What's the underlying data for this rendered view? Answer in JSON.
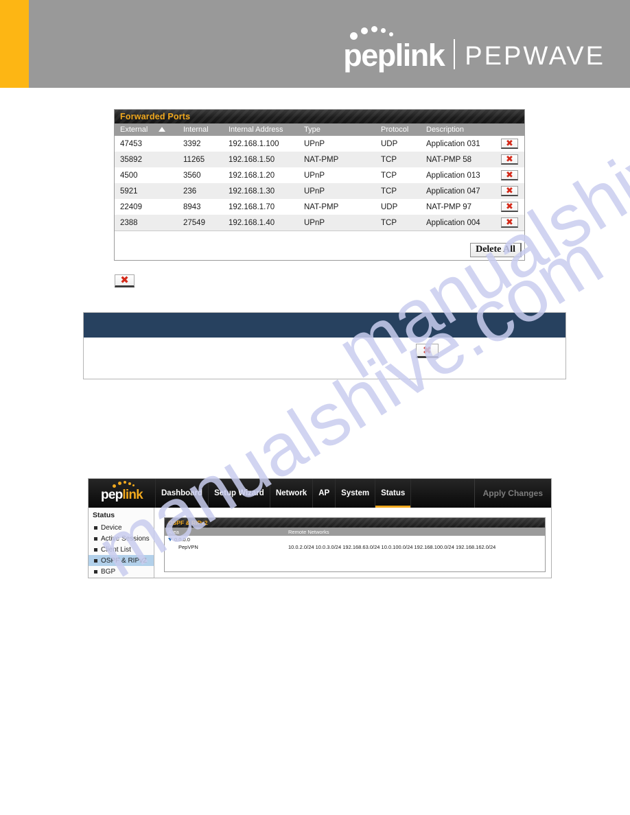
{
  "document_header": {
    "brand_primary": "peplink",
    "brand_secondary": "PEPWAVE",
    "accent_orange": "#fdb614",
    "band_gray": "#999999"
  },
  "watermark": {
    "text": "manualshive.com"
  },
  "forwarded_ports": {
    "title": "Forwarded Ports",
    "title_color": "#f0a81e",
    "columns": [
      "External",
      "Internal",
      "Internal Address",
      "Type",
      "Protocol",
      "Description"
    ],
    "sort_column": "External",
    "sort_direction": "ascending",
    "sort_icon": "sort-ascending-arrow-icon",
    "rows": [
      {
        "external": "47453",
        "internal": "3392",
        "internal_address": "192.168.1.100",
        "type": "UPnP",
        "protocol": "UDP",
        "description": "Application 031",
        "delete_icon": "delete-x-icon"
      },
      {
        "external": "35892",
        "internal": "11265",
        "internal_address": "192.168.1.50",
        "type": "NAT-PMP",
        "protocol": "TCP",
        "description": "NAT-PMP 58",
        "delete_icon": "delete-x-icon"
      },
      {
        "external": "4500",
        "internal": "3560",
        "internal_address": "192.168.1.20",
        "type": "UPnP",
        "protocol": "TCP",
        "description": "Application 013",
        "delete_icon": "delete-x-icon"
      },
      {
        "external": "5921",
        "internal": "236",
        "internal_address": "192.168.1.30",
        "type": "UPnP",
        "protocol": "TCP",
        "description": "Application 047",
        "delete_icon": "delete-x-icon"
      },
      {
        "external": "22409",
        "internal": "8943",
        "internal_address": "192.168.1.70",
        "type": "NAT-PMP",
        "protocol": "UDP",
        "description": "NAT-PMP 97",
        "delete_icon": "delete-x-icon"
      },
      {
        "external": "2388",
        "internal": "27549",
        "internal_address": "192.168.1.40",
        "type": "UPnP",
        "protocol": "TCP",
        "description": "Application 004",
        "delete_icon": "delete-x-icon"
      }
    ],
    "delete_all_label": "Delete All"
  },
  "standalone_icon": {
    "name": "broken-image-x-icon",
    "glyph": "✖"
  },
  "note_box": {
    "header_color": "#27415f",
    "header_text": "",
    "body_text": "",
    "body_icon": "broken-image-x-icon",
    "body_icon_glyph": "✖"
  },
  "web_ui": {
    "logo": {
      "part1": "pep",
      "part2": "link",
      "dots_icon": "peplink-dots-icon"
    },
    "nav_items": [
      {
        "label": "Dashboard",
        "active": false
      },
      {
        "label": "Setup Wizard",
        "active": false
      },
      {
        "label": "Network",
        "active": false
      },
      {
        "label": "AP",
        "active": false
      },
      {
        "label": "System",
        "active": false
      },
      {
        "label": "Status",
        "active": true
      }
    ],
    "apply_changes_label": "Apply Changes",
    "sidebar": {
      "title": "Status",
      "items": [
        {
          "label": "Device",
          "selected": false
        },
        {
          "label": "Active Sessions",
          "selected": false
        },
        {
          "label": "Client List",
          "selected": false
        },
        {
          "label": "OSPF & RIPv2",
          "selected": true
        },
        {
          "label": "BGP",
          "selected": false
        }
      ]
    },
    "ospf_panel": {
      "title": "OSPF & RIPv2",
      "columns": [
        "Area",
        "Remote Networks"
      ],
      "rows": [
        {
          "area": "0.0.0.0",
          "remote_networks": "",
          "expand_icon": "triangle-down-icon",
          "is_group": true
        },
        {
          "area": "PepVPN",
          "remote_networks": "10.0.2.0/24 10.0.3.0/24 192.168.63.0/24 10.0.100.0/24 192.168.100.0/24 192.168.162.0/24",
          "is_group": false
        }
      ]
    }
  }
}
